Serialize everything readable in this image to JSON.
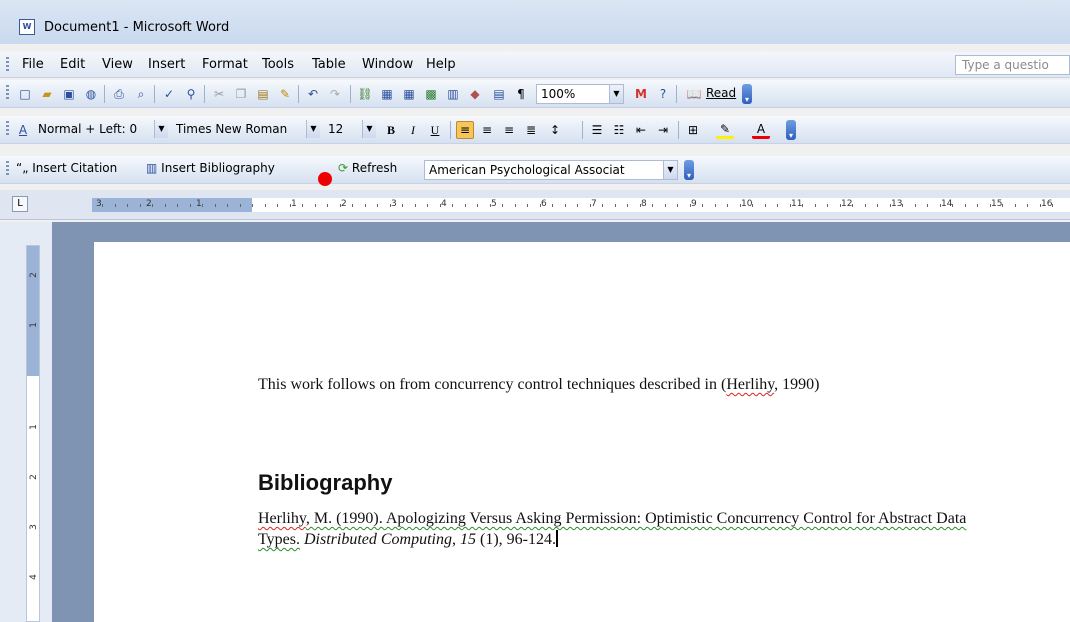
{
  "window": {
    "title": "Document1 - Microsoft Word"
  },
  "menu": {
    "items": [
      "File",
      "Edit",
      "View",
      "Insert",
      "Format",
      "Tools",
      "Table",
      "Window",
      "Help"
    ],
    "help_placeholder": "Type a questio"
  },
  "standard_toolbar": {
    "zoom": "100%",
    "read_label": "Read"
  },
  "formatting_toolbar": {
    "style": "Normal + Left: 0",
    "font": "Times New Roman",
    "size": "12",
    "bold": "B",
    "italic": "I",
    "underline": "U"
  },
  "citations_toolbar": {
    "insert_citation": "Insert Citation",
    "insert_bibliography": "Insert Bibliography",
    "refresh": "Refresh",
    "style": "American Psychological Associat"
  },
  "ruler": {
    "numbers": [
      "3",
      "2",
      "1",
      "1",
      "2",
      "3",
      "4",
      "5",
      "6",
      "7",
      "8",
      "9",
      "10",
      "11",
      "12",
      "13",
      "14",
      "15",
      "16"
    ],
    "vertical_numbers": [
      "2",
      "1",
      "1",
      "2",
      "3",
      "4"
    ]
  },
  "document": {
    "paragraph_text": "This work follows on from concurrency control techniques described in (",
    "paragraph_citation": "Herlihy",
    "paragraph_after": ", 1990)",
    "bibliography_heading": "Bibliography",
    "entry_author": "Herlihy",
    "entry_rest_1": ", M. (1990). Apologizing Versus Asking Permission: Optimistic Concurrency Control for Abstract Data Types.",
    "entry_journal": "Distributed Computing",
    "entry_sep": ",",
    "entry_volume": "15",
    "entry_tail": "(1), 96-124."
  }
}
